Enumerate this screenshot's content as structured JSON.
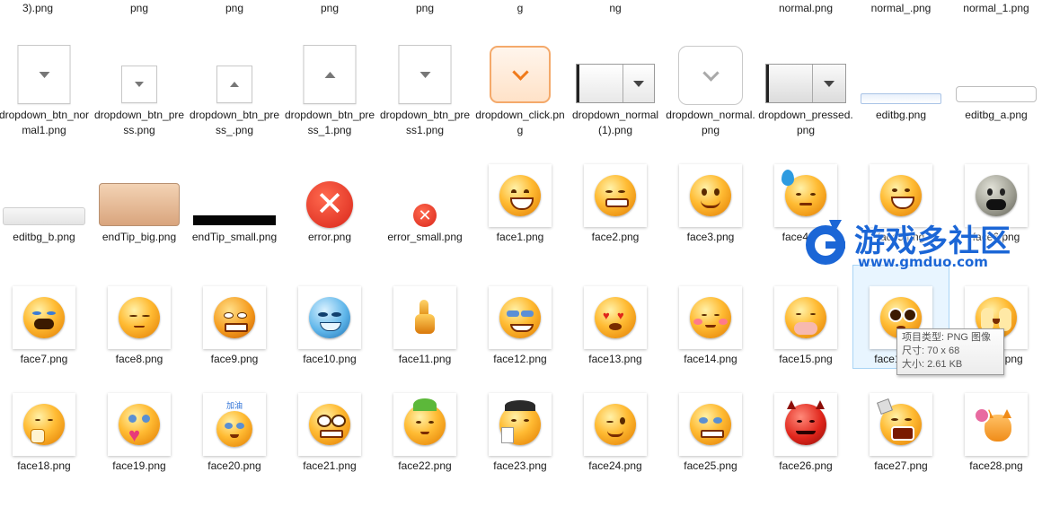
{
  "top_row": [
    "3).png",
    "png",
    "png",
    "png",
    "png",
    "g",
    "ng",
    "",
    "normal.png",
    "normal_.png",
    "normal_1.png"
  ],
  "row1": [
    "dropdown_btn_normal1.png",
    "dropdown_btn_press.png",
    "dropdown_btn_press_.png",
    "dropdown_btn_press_1.png",
    "dropdown_btn_press1.png",
    "dropdown_click.png",
    "dropdown_normal(1).png",
    "dropdown_normal.png",
    "dropdown_pressed.png",
    "editbg.png",
    "editbg_a.png"
  ],
  "row2": [
    "editbg_b.png",
    "endTip_big.png",
    "endTip_small.png",
    "error.png",
    "error_small.png",
    "face1.png",
    "face2.png",
    "face3.png",
    "face4.png",
    "face5.png",
    "face6.png"
  ],
  "row3": [
    "face7.png",
    "face8.png",
    "face9.png",
    "face10.png",
    "face11.png",
    "face12.png",
    "face13.png",
    "face14.png",
    "face15.png",
    "face16.png",
    "face17.png"
  ],
  "row4": [
    "face18.png",
    "face19.png",
    "face20.png",
    "face21.png",
    "face22.png",
    "face23.png",
    "face24.png",
    "face25.png",
    "face26.png",
    "face27.png",
    "face28.png"
  ],
  "face20_caption": "加油",
  "watermark": {
    "title": "游戏多社区",
    "url": "www.gmduo.com"
  },
  "tooltip": {
    "type": "项目类型: PNG 图像",
    "size": "尺寸: 70 x 68",
    "filesize": "大小: 2.61 KB"
  },
  "colors": {
    "accent": "#1b66d6",
    "selection": "#cce8ff",
    "error_red": "#e8331f",
    "click_orange": "#f07a1a"
  }
}
